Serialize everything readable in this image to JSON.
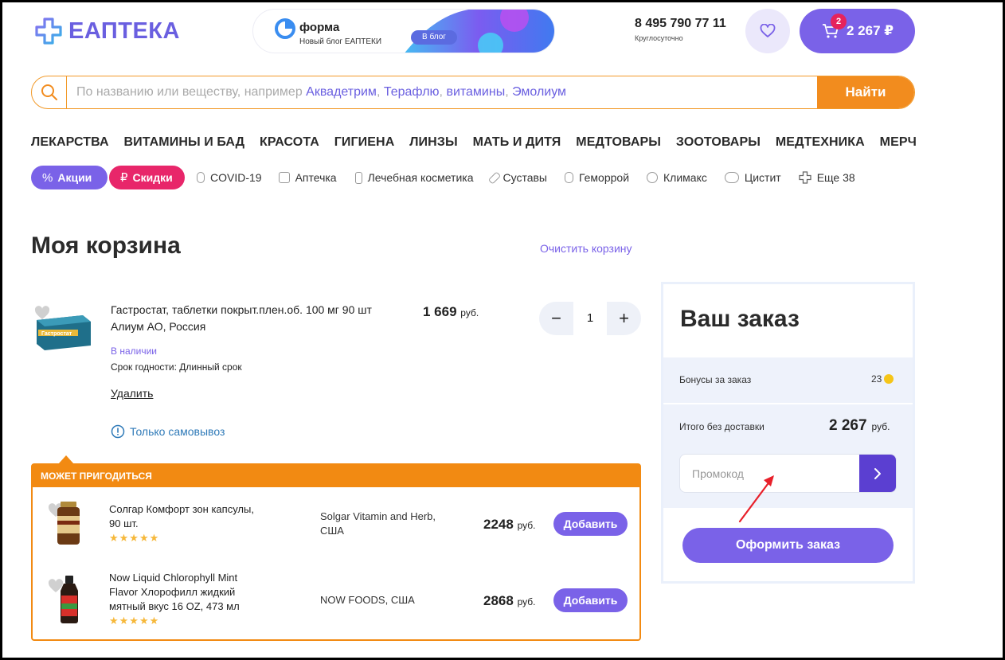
{
  "header": {
    "logo_text": "ЕАПТЕКА",
    "banner": {
      "title": "форма",
      "subtitle": "Новый блог ЕАПТЕКИ",
      "button": "В блог"
    },
    "phone": "8 495 790 77 11",
    "phone_note": "Круглосуточно",
    "cart": {
      "count": "2",
      "total": "2 267 ₽"
    }
  },
  "search": {
    "placeholder_prefix": "По названию или веществу, например ",
    "examples": [
      "Аквадетрим",
      "Терафлю",
      "витамины",
      "Эмолиум"
    ],
    "separator": ", ",
    "button": "Найти"
  },
  "categories": [
    "ЛЕКАРСТВА",
    "ВИТАМИНЫ И БАД",
    "КРАСОТА",
    "ГИГИЕНА",
    "ЛИНЗЫ",
    "МАТЬ И ДИТЯ",
    "МЕДТОВАРЫ",
    "ЗООТОВАРЫ",
    "МЕДТЕХНИКА",
    "МЕРЧ"
  ],
  "tags": {
    "promo": "Акции",
    "discounts": "Скидки",
    "items": [
      "COVID-19",
      "Аптечка",
      "Лечебная косметика",
      "Суставы",
      "Геморрой",
      "Климакс",
      "Цистит",
      "Еще 38"
    ]
  },
  "cart_page": {
    "title": "Моя корзина",
    "clear": "Очистить корзину",
    "item": {
      "name": "Гастростат, таблетки покрыт.плен.об. 100 мг 90 шт",
      "maker": "Алиум АО, Россия",
      "stock": "В наличии",
      "expiry": "Срок годности: Длинный срок",
      "remove": "Удалить",
      "pickup": "Только самовывоз",
      "price": "1 669",
      "currency": "руб.",
      "quantity": "1",
      "minus": "−",
      "plus": "+",
      "box_label": "Гастростат"
    },
    "recommendations": {
      "header": "МОЖЕТ ПРИГОДИТЬСЯ",
      "items": [
        {
          "name": "Солгар Комфорт зон капсулы, 90 шт.",
          "brand": "Solgar Vitamin and Herb, США",
          "price": "2248",
          "currency": "руб.",
          "button": "Добавить",
          "rating": 5,
          "stars": "★★★★★"
        },
        {
          "name": "Now Liquid Chlorophyll Mint Flavor Хлорофилл жидкий мятный вкус 16 OZ, 473 мл",
          "brand": "NOW FOODS, США",
          "price": "2868",
          "currency": "руб.",
          "button": "Добавить",
          "rating": 5,
          "stars": "★★★★★"
        }
      ]
    }
  },
  "order": {
    "title": "Ваш заказ",
    "bonus_label": "Бонусы за заказ",
    "bonus_value": "23",
    "total_label": "Итого без доставки",
    "total_value": "2 267",
    "currency": "руб.",
    "promo_placeholder": "Промокод",
    "checkout": "Оформить заказ"
  },
  "colors": {
    "brand_purple": "#7a62e8",
    "orange": "#f28a12",
    "pink": "#e8266a",
    "annotation_red": "#e8202a"
  }
}
